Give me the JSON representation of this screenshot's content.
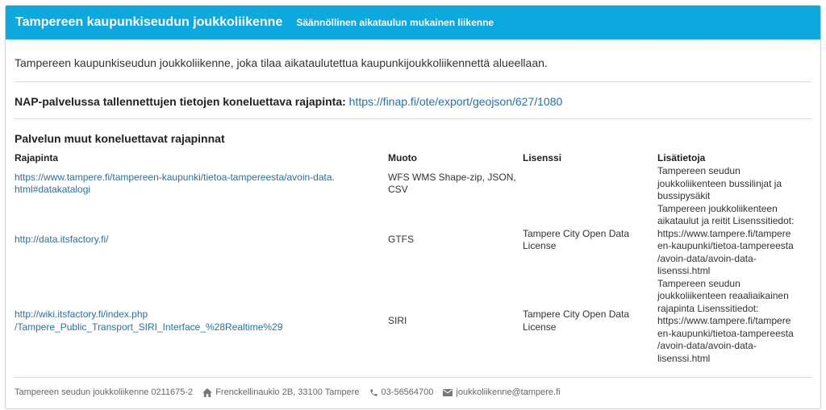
{
  "header": {
    "title": "Tampereen kaupunkiseudun joukkoliikenne",
    "subtitle": "Säännöllinen aikataulun mukainen liikenne"
  },
  "description": "Tampereen kaupunkiseudun joukkoliikenne, joka tilaa aikataulutettua kaupunkijoukkoliikennettä alueellaan.",
  "nap": {
    "label": "NAP-palvelussa tallennettujen tietojen koneluettava rajapinta:",
    "url": "https://finap.fi/ote/export/geojson/627/1080"
  },
  "other_interfaces": {
    "title": "Palvelun muut koneluettavat rajapinnat",
    "columns": [
      "Rajapinta",
      "Muoto",
      "Lisenssi",
      "Lisätietoja"
    ],
    "rows": [
      {
        "url": "https://www.tampere.fi/tampereen-kaupunki/tietoa-tampereesta/avoin-data.html#datakatalogi",
        "format": "WFS WMS Shape-zip, JSON, CSV",
        "license": "",
        "info": "Tampereen seudun joukkoliikenteen bussilinjat ja bussipysäkit"
      },
      {
        "url": "http://data.itsfactory.fi/",
        "format": "GTFS",
        "license": "Tampere City Open Data License",
        "info": "Tampereen joukkoliikenteen aikataulut ja reitit Lisenssitiedot: https://www.tampere.fi/tampereen-kaupunki/tietoa-tampereesta /avoin-data/avoin-data-lisenssi.html"
      },
      {
        "url": "http://wiki.itsfactory.fi/index.php /Tampere_Public_Transport_SIRI_Interface_%28Realtime%29",
        "format": "SIRI",
        "license": "Tampere City Open Data License",
        "info": "Tampereen seudun joukkoliikenteen reaaliaikainen rajapinta Lisenssitiedot: https://www.tampere.fi/tampereen-kaupunki/tietoa-tampereesta /avoin-data/avoin-data-lisenssi.html"
      }
    ]
  },
  "footer": {
    "company": "Tampereen seudun joukkoliikenne 0211675-2",
    "address": "Frenckellinaukio 2B, 33100 Tampere",
    "phone": "03-56564700",
    "email": "joukkoliikenne@tampere.fi",
    "icons": [
      "home-icon",
      "phone-icon",
      "email-icon"
    ]
  },
  "colors": {
    "header_bg": "#0ca8de",
    "link": "#2a6fa8"
  }
}
